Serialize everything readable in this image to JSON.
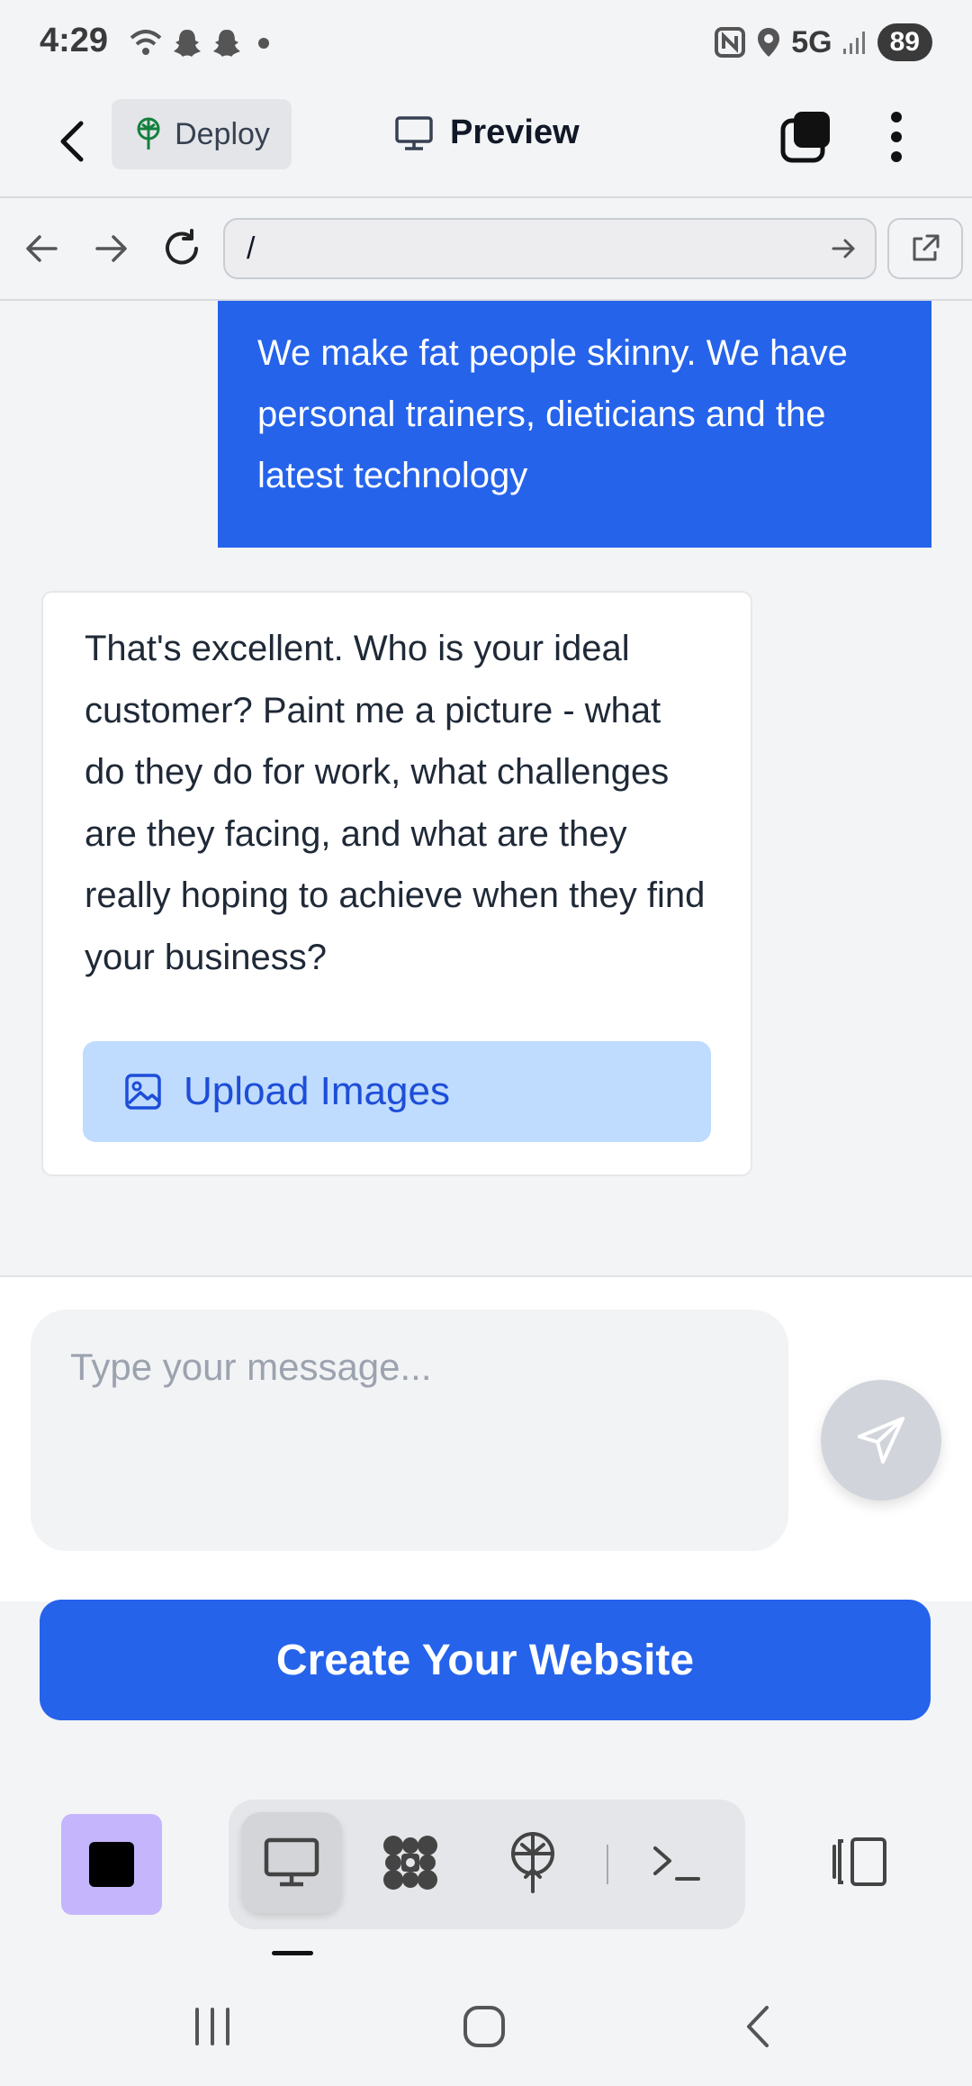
{
  "status_bar": {
    "time": "4:29",
    "network": "5G",
    "battery": "89"
  },
  "app_bar": {
    "deploy_label": "Deploy",
    "preview_label": "Preview"
  },
  "url_bar": {
    "value": "/"
  },
  "chat": {
    "user_message": "We make fat people skinny. We have personal trainers, dieticians and the latest technology",
    "assistant_message": "That's excellent. Who is your ideal customer? Paint me a picture - what do they do for work, what challenges are they facing, and what are they really hoping to achieve when they find your business?",
    "upload_label": "Upload Images"
  },
  "composer": {
    "placeholder": "Type your message..."
  },
  "cta": {
    "label": "Create Your Website"
  },
  "colors": {
    "accent": "#2563eb",
    "upload_bg": "#bfdbfe",
    "stop_bg": "#c4b5fd"
  },
  "icons": {
    "status": [
      "wifi-icon",
      "snapchat-icon",
      "snapchat-icon",
      "dot-icon",
      "nfc-icon",
      "location-icon",
      "signal-icon"
    ],
    "toolbar": [
      "monitor-icon",
      "apps-icon",
      "deploy-icon",
      "terminal-icon",
      "layout-icon"
    ]
  }
}
